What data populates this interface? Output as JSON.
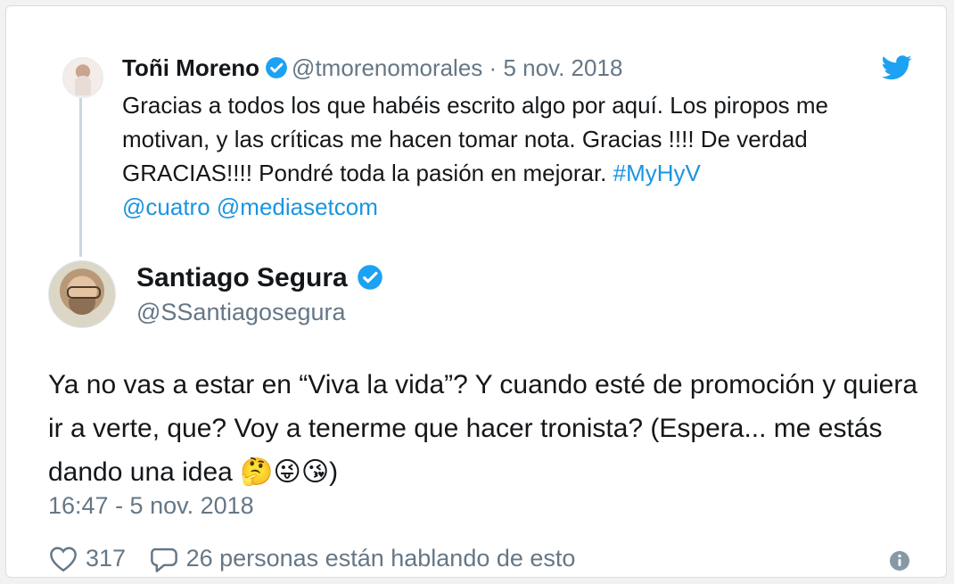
{
  "parent_tweet": {
    "name": "Toñi Moreno",
    "handle": "@tmorenomorales",
    "separator": "·",
    "date": "5 nov. 2018",
    "text_plain": "Gracias a todos los que habéis escrito algo por aquí. Los piropos me motivan,  y las críticas me hacen tomar nota.  Gracias !!!! De verdad GRACIAS!!!! Pondré toda la pasión en mejorar. ",
    "hashtag": "#MyHyV",
    "mention1": "@cuatro",
    "mention2": "@mediasetcom"
  },
  "reply_tweet": {
    "name": "Santiago Segura",
    "handle": "@SSantiagosegura",
    "text": "Ya no vas a estar en “Viva la vida”? Y cuando esté de promoción y quiera ir a verte, que? Voy a tenerme que hacer tronista? (Espera... me estás dando una idea ",
    "emojis": "🤔😜😘",
    "text_end": ")",
    "time": "16:47 - 5 nov. 2018"
  },
  "actions": {
    "likes": "317",
    "conversation": "26 personas están hablando de esto"
  },
  "colors": {
    "link": "#1b95e0",
    "verified": "#1da1f2",
    "meta": "#657786"
  },
  "icons": [
    "twitter-bird-icon",
    "verified-badge-icon",
    "heart-icon",
    "reply-bubble-icon",
    "info-icon"
  ]
}
